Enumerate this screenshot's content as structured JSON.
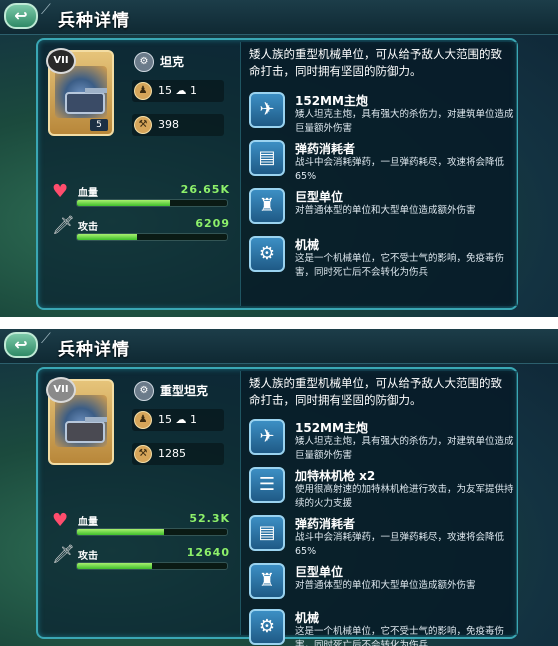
{
  "panels": [
    {
      "header_title": "兵种详情",
      "rank": "VII",
      "level": "5",
      "unit_name": "坦克",
      "population": "15",
      "population_extra": "1",
      "cost": "398",
      "hp_label": "血量",
      "hp_value": "26.65K",
      "hp_fraction": 0.62,
      "atk_label": "攻击",
      "atk_value": "6209",
      "atk_fraction": 0.4,
      "description": "矮人族的重型机械单位，可从给予敌人大范围的致命打击，同时拥有坚固的防御力。",
      "skills": [
        {
          "name": "152MM主炮",
          "text": "矮人坦克主炮，具有强大的杀伤力，对建筑单位造成巨量额外伤害",
          "icon": "cannon-icon"
        },
        {
          "name": "弹药消耗者",
          "text": "战斗中会消耗弹药，一旦弹药耗尽，攻速将会降低65%",
          "icon": "ammo-icon"
        },
        {
          "name": "巨型单位",
          "text": "对普通体型的单位和大型单位造成额外伤害",
          "icon": "giant-icon"
        },
        {
          "name": "机械",
          "text": "这是一个机械单位，它不受士气的影响，免疫毒伤害，同时死亡后不会转化为伤兵",
          "icon": "gear-icon"
        }
      ]
    },
    {
      "header_title": "兵种详情",
      "rank": "VII",
      "level": "",
      "unit_name": "重型坦克",
      "population": "15",
      "population_extra": "1",
      "cost": "1285",
      "hp_label": "血量",
      "hp_value": "52.3K",
      "hp_fraction": 0.58,
      "atk_label": "攻击",
      "atk_value": "12640",
      "atk_fraction": 0.5,
      "description": "矮人族的重型机械单位，可从给予敌人大范围的致命打击，同时拥有坚固的防御力。",
      "skills": [
        {
          "name": "152MM主炮",
          "text": "矮人坦克主炮，具有强大的杀伤力，对建筑单位造成巨量额外伤害",
          "icon": "cannon-icon"
        },
        {
          "name": "加特林机枪 x2",
          "text": "使用很高射速的加特林机枪进行攻击，为友军提供持续的火力支援",
          "icon": "gatling-icon"
        },
        {
          "name": "弹药消耗者",
          "text": "战斗中会消耗弹药，一旦弹药耗尽，攻速将会降低65%",
          "icon": "ammo-icon"
        },
        {
          "name": "巨型单位",
          "text": "对普通体型的单位和大型单位造成额外伤害",
          "icon": "giant-icon"
        },
        {
          "name": "机械",
          "text": "这是一个机械单位，它不受士气的影响，免疫毒伤害，同时死亡后不会转化为伤兵",
          "icon": "gear-icon"
        }
      ]
    }
  ]
}
